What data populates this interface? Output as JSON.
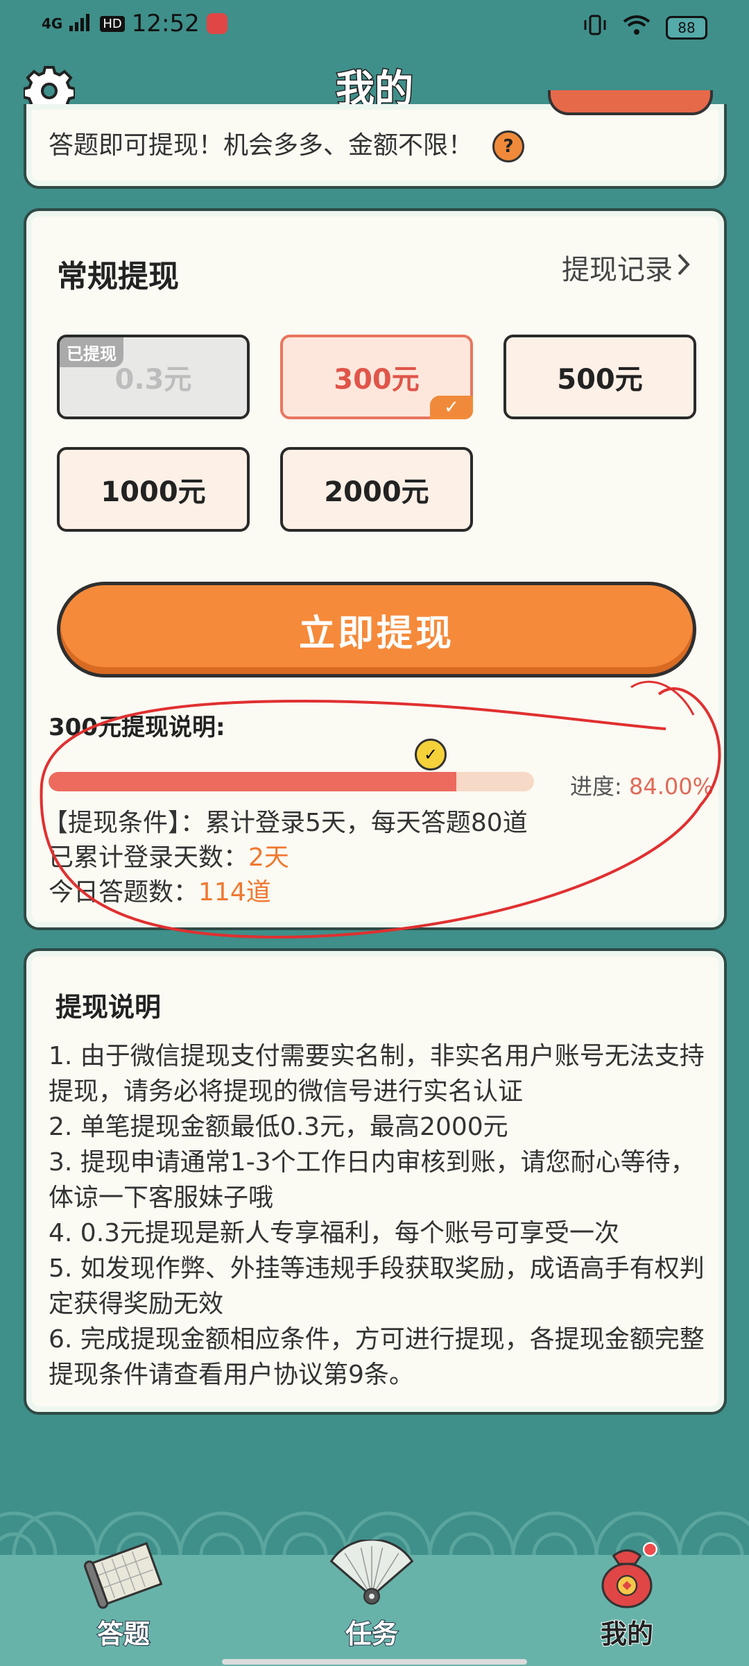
{
  "status": {
    "network": "4G",
    "hd": "HD",
    "time": "12:52",
    "battery": "88"
  },
  "header": {
    "title": "我的"
  },
  "top_card": {
    "text": "答题即可提现！机会多多、金额不限！",
    "help": "?"
  },
  "withdraw": {
    "title": "常规提现",
    "record_label": "提现记录",
    "options": [
      {
        "label": "0.3元",
        "state": "disabled",
        "tag": "已提现"
      },
      {
        "label": "300元",
        "state": "selected"
      },
      {
        "label": "500元",
        "state": "normal"
      },
      {
        "label": "1000元",
        "state": "normal"
      },
      {
        "label": "2000元",
        "state": "normal"
      }
    ],
    "button_label": "立即提现",
    "explain_title": "300元提现说明:",
    "progress_prefix": "进度: ",
    "progress_text": "84.00%",
    "progress_value": 0.84,
    "condition": "【提现条件】：累计登录5天，每天答题80道",
    "login_days_label": "已累计登录天数：",
    "login_days_value": "2天",
    "today_label": "今日答题数：",
    "today_value": "114道"
  },
  "rules": {
    "title": "提现说明",
    "items": [
      "1. 由于微信提现支付需要实名制，非实名用户账号无法支持提现，请务必将提现的微信号进行实名认证",
      "2. 单笔提现金额最低0.3元，最高2000元",
      "3. 提现申请通常1-3个工作日内审核到账，请您耐心等待，体谅一下客服妹子哦",
      "4. 0.3元提现是新人专享福利，每个账号可享受一次",
      "5. 如发现作弊、外挂等违规手段获取奖励，成语高手有权判定获得奖励无效",
      "6. 完成提现金额相应条件，方可进行提现，各提现金额完整提现条件请查看用户协议第9条。"
    ]
  },
  "tabs": [
    {
      "label": "答题",
      "icon": "scroll-icon"
    },
    {
      "label": "任务",
      "icon": "fan-icon"
    },
    {
      "label": "我的",
      "icon": "money-bag-icon",
      "active": true
    }
  ],
  "colors": {
    "accent": "#f58a3a",
    "bg": "#3f8f8a",
    "progress": "#ec6b5e",
    "annotation": "#e03030"
  }
}
